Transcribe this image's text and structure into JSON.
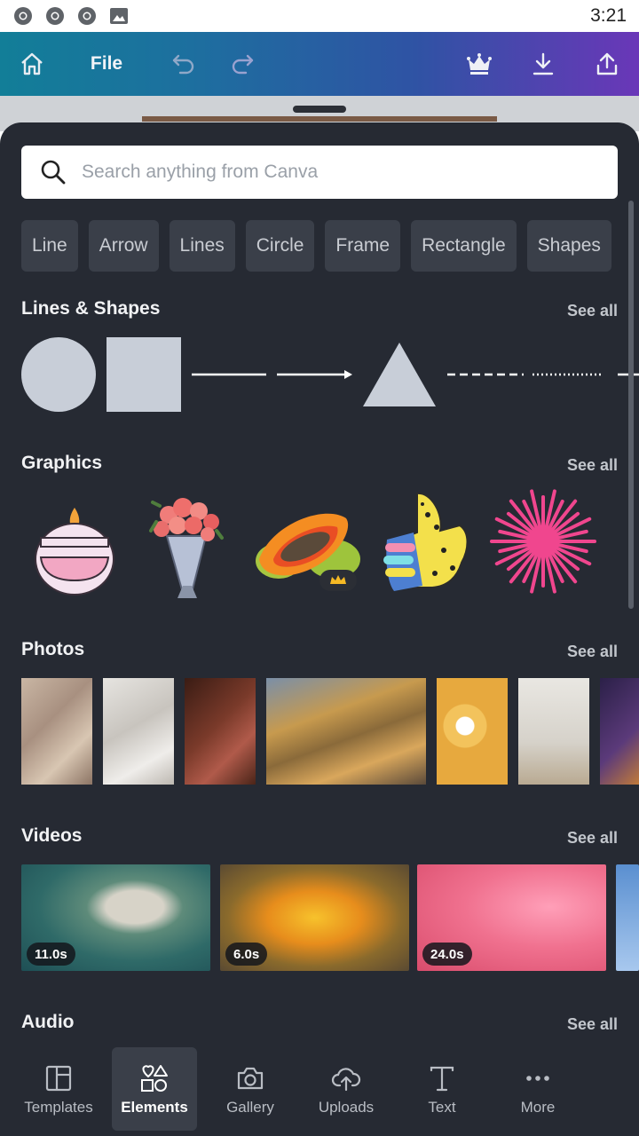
{
  "status_bar": {
    "time": "3:21",
    "icons": [
      "chrome-icon",
      "chrome-icon",
      "chrome-icon",
      "image-icon"
    ]
  },
  "toolbar": {
    "file_label": "File",
    "icons": [
      "home-icon",
      "undo-icon",
      "redo-icon",
      "crown-icon",
      "download-icon",
      "share-icon"
    ]
  },
  "search": {
    "placeholder": "Search anything from Canva"
  },
  "chips": [
    "Line",
    "Arrow",
    "Lines",
    "Circle",
    "Frame",
    "Rectangle",
    "Shapes"
  ],
  "sections": {
    "lines_shapes": {
      "title": "Lines & Shapes",
      "see_all": "See all"
    },
    "graphics": {
      "title": "Graphics",
      "see_all": "See all"
    },
    "photos": {
      "title": "Photos",
      "see_all": "See all"
    },
    "videos": {
      "title": "Videos",
      "see_all": "See all"
    },
    "audio": {
      "title": "Audio",
      "see_all": "See all"
    }
  },
  "videos": [
    {
      "duration": "11.0s"
    },
    {
      "duration": "6.0s"
    },
    {
      "duration": "24.0s"
    }
  ],
  "bottom_nav": [
    {
      "label": "Templates",
      "icon": "templates-icon"
    },
    {
      "label": "Elements",
      "icon": "elements-icon",
      "active": true
    },
    {
      "label": "Gallery",
      "icon": "camera-icon"
    },
    {
      "label": "Uploads",
      "icon": "cloud-upload-icon"
    },
    {
      "label": "Text",
      "icon": "text-icon"
    },
    {
      "label": "More",
      "icon": "more-icon"
    }
  ],
  "colors": {
    "panel": "#262a33",
    "chip": "#3a3f49",
    "shape": "#c8ced8",
    "toolbar_start": "#127e98",
    "toolbar_end": "#6a37b8"
  }
}
